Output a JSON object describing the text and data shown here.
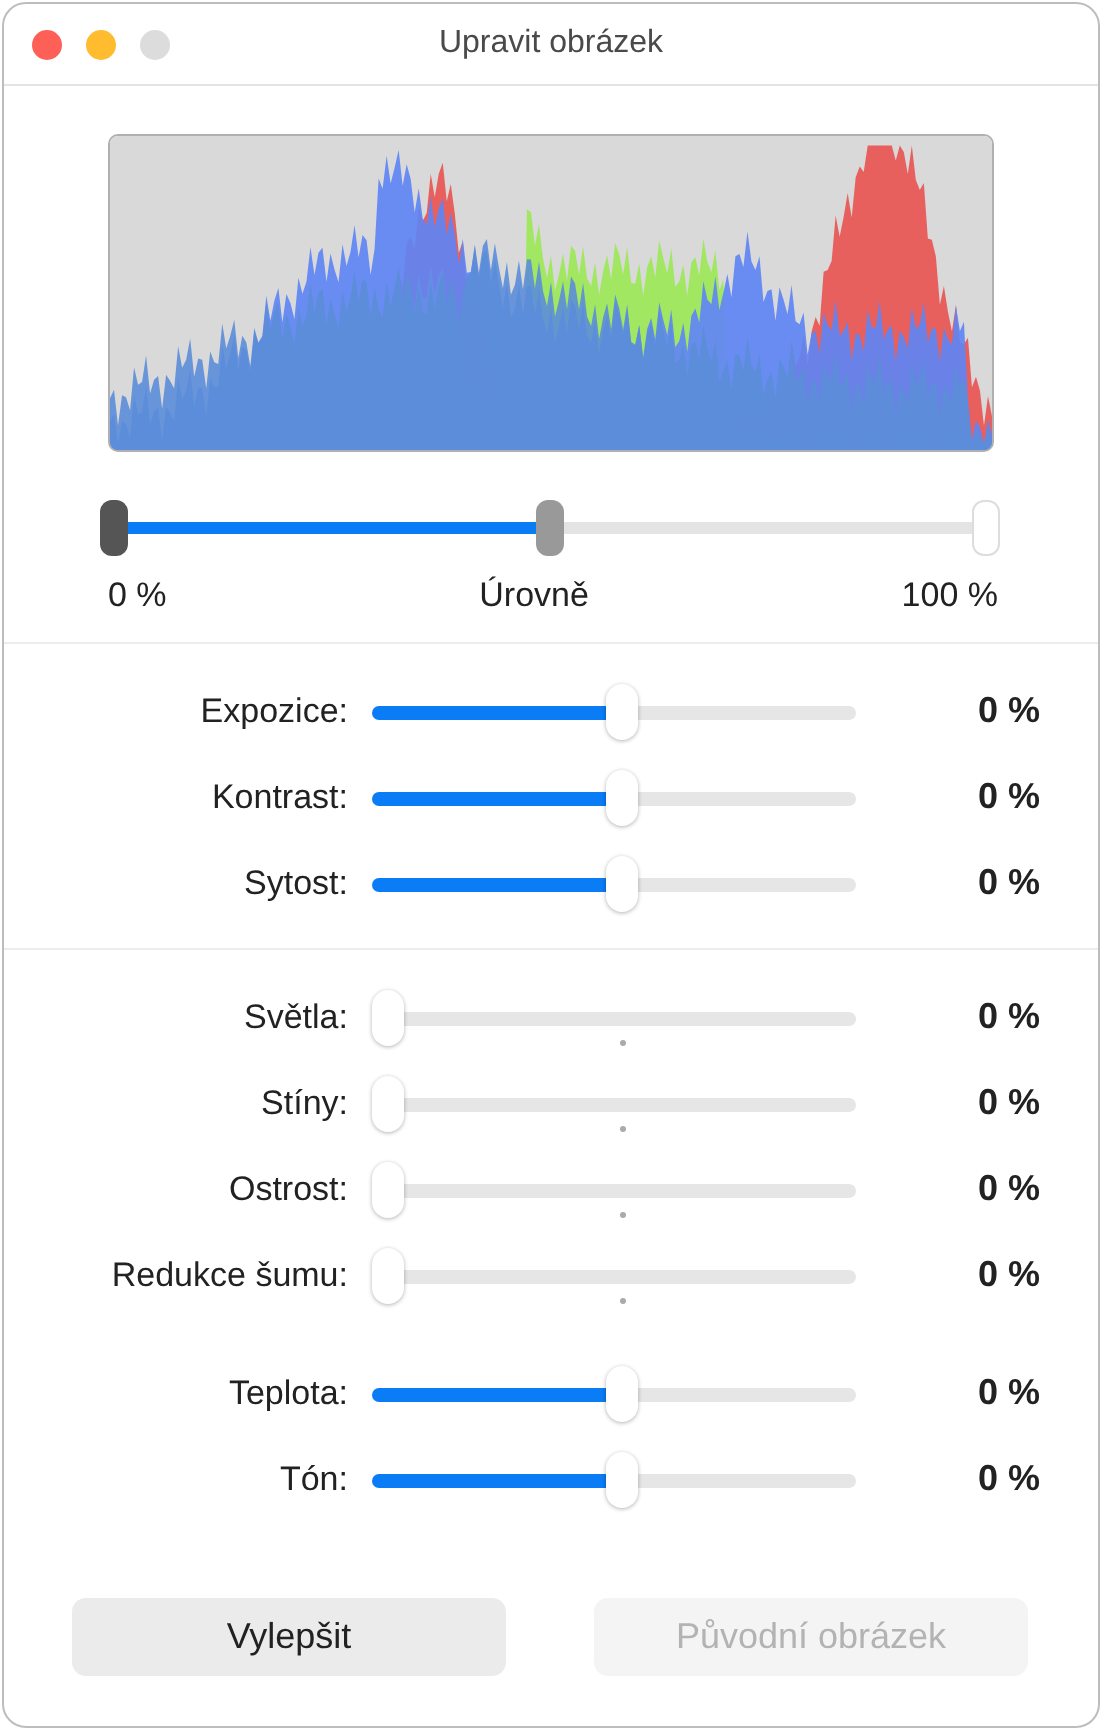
{
  "window": {
    "title": "Upravit obrázek"
  },
  "levels": {
    "label": "Úrovně",
    "min_label": "0 %",
    "max_label": "100 %",
    "thumbs": [
      {
        "kind": "black",
        "level": 0
      },
      {
        "kind": "gray",
        "level": 0.5
      },
      {
        "kind": "white",
        "level": 1
      }
    ]
  },
  "sections": [
    {
      "groups": [
        {
          "rows": [
            {
              "label": "Expozice:",
              "kind": "bipolar",
              "level": 0.5,
              "reading": "0 %"
            },
            {
              "label": "Kontrast:",
              "kind": "bipolar",
              "level": 0.5,
              "reading": "0 %"
            },
            {
              "label": "Sytost:",
              "kind": "bipolar",
              "level": 0.5,
              "reading": "0 %"
            }
          ]
        }
      ]
    },
    {
      "groups": [
        {
          "rows": [
            {
              "label": "Světla:",
              "kind": "unipolar",
              "level": 0,
              "reading": "0 %"
            },
            {
              "label": "Stíny:",
              "kind": "unipolar",
              "level": 0,
              "reading": "0 %"
            },
            {
              "label": "Ostrost:",
              "kind": "unipolar",
              "level": 0,
              "reading": "0 %"
            },
            {
              "label": "Redukce šumu:",
              "kind": "unipolar",
              "level": 0,
              "reading": "0 %"
            }
          ]
        },
        {
          "rows": [
            {
              "label": "Teplota:",
              "kind": "bipolar",
              "level": 0.5,
              "reading": "0 %"
            },
            {
              "label": "Tón:",
              "kind": "bipolar",
              "level": 0.5,
              "reading": "0 %"
            }
          ]
        }
      ]
    }
  ],
  "buttons": [
    {
      "label": "Vylepšit",
      "disabled": false
    },
    {
      "label": "Původní obrázek",
      "disabled": true
    }
  ]
}
